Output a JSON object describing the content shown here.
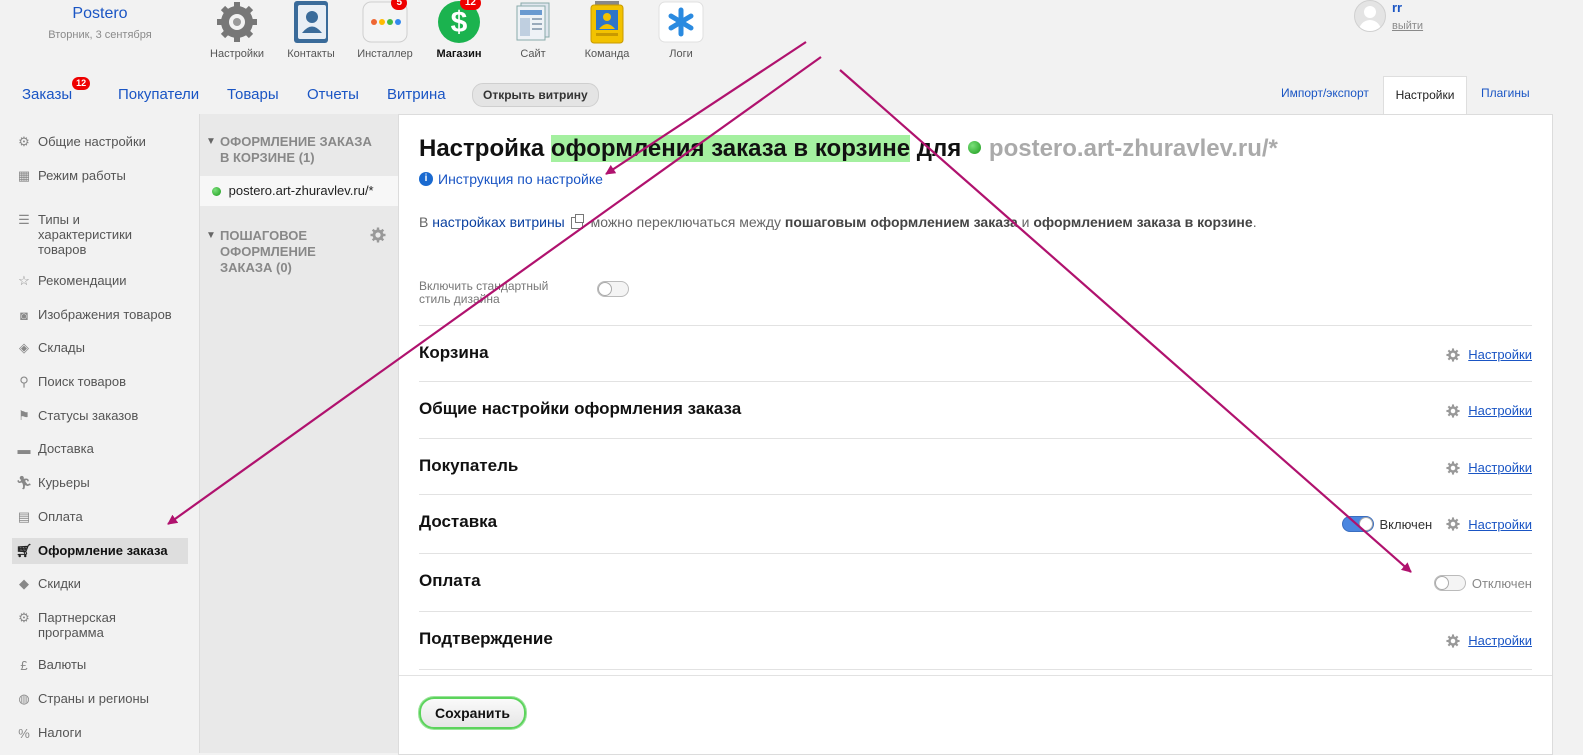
{
  "brand": {
    "name": "Postero",
    "date": "Вторник, 3 сентября"
  },
  "apps": [
    {
      "label": "Настройки",
      "icon": "gear-icon",
      "badge": ""
    },
    {
      "label": "Контакты",
      "icon": "contacts-icon",
      "badge": ""
    },
    {
      "label": "Инсталлер",
      "icon": "installer-icon",
      "badge": "5"
    },
    {
      "label": "Магазин",
      "icon": "shop-icon",
      "badge": "12"
    },
    {
      "label": "Сайт",
      "icon": "site-icon",
      "badge": ""
    },
    {
      "label": "Команда",
      "icon": "team-icon",
      "badge": ""
    },
    {
      "label": "Логи",
      "icon": "logs-icon",
      "badge": ""
    }
  ],
  "user": {
    "name": "rr",
    "logout": "выйти"
  },
  "nav": {
    "orders": "Заказы",
    "orders_badge": "12",
    "customers": "Покупатели",
    "products": "Товары",
    "reports": "Отчеты",
    "storefront": "Витрина",
    "open_storefront": "Открыть витрину",
    "import_export": "Импорт/экспорт",
    "settings": "Настройки",
    "plugins": "Плагины"
  },
  "sidebar": {
    "items": [
      {
        "label": "Общие настройки",
        "icon": "cogs-icon"
      },
      {
        "label": "Режим работы",
        "icon": "calendar-icon"
      },
      {
        "label": "Типы и характеристики товаров",
        "icon": "list-icon"
      },
      {
        "label": "Рекомендации",
        "icon": "star-icon"
      },
      {
        "label": "Изображения товаров",
        "icon": "camera-icon"
      },
      {
        "label": "Склады",
        "icon": "box-icon"
      },
      {
        "label": "Поиск товаров",
        "icon": "search-icon"
      },
      {
        "label": "Статусы заказов",
        "icon": "flag-icon"
      },
      {
        "label": "Доставка",
        "icon": "truck-icon"
      },
      {
        "label": "Курьеры",
        "icon": "courier-icon"
      },
      {
        "label": "Оплата",
        "icon": "money-icon"
      },
      {
        "label": "Оформление заказа",
        "icon": "cart-icon"
      },
      {
        "label": "Скидки",
        "icon": "tag-icon"
      },
      {
        "label": "Партнерская программа",
        "icon": "affiliate-icon"
      },
      {
        "label": "Валюты",
        "icon": "pound-icon"
      },
      {
        "label": "Страны и регионы",
        "icon": "globe-icon"
      },
      {
        "label": "Налоги",
        "icon": "percent-icon"
      }
    ],
    "active_index": 11
  },
  "midcol": {
    "group1": "ОФОРМЛЕНИЕ ЗАКАЗА В КОРЗИНЕ (1)",
    "site": "postero.art-zhuravlev.ru/*",
    "group2": "ПОШАГОВОЕ ОФОРМЛЕНИЕ ЗАКАЗА (0)"
  },
  "panel": {
    "title_pre": "Настройка ",
    "title_hl": "оформления заказа в корзине",
    "title_mid": " для ",
    "title_domain": "postero.art-zhuravlev.ru/*",
    "guide_link": "Инструкция по настройке",
    "desc_pre": "В ",
    "desc_link": "настройках витрины",
    "desc_mid": " можно переключаться между ",
    "desc_b1": "пошаговым оформлением заказа",
    "desc_and": " и ",
    "desc_b2": "оформлением заказа в корзине",
    "desc_end": ".",
    "std_style_label": "Включить стандартный стиль дизайна",
    "sections": [
      {
        "title": "Корзина",
        "link": "Настройки",
        "state": ""
      },
      {
        "title": "Общие настройки оформления заказа",
        "link": "Настройки",
        "state": ""
      },
      {
        "title": "Покупатель",
        "link": "Настройки",
        "state": ""
      },
      {
        "title": "Доставка",
        "link": "Настройки",
        "state": "Включен"
      },
      {
        "title": "Оплата",
        "link": "",
        "state": "Отключен"
      },
      {
        "title": "Подтверждение",
        "link": "Настройки",
        "state": ""
      }
    ],
    "save": "Сохранить"
  },
  "annotation_color": "#b0126e"
}
